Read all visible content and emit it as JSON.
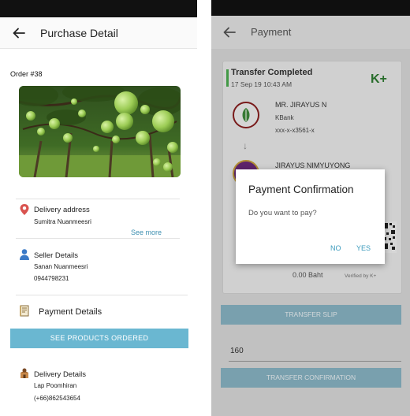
{
  "purchase": {
    "title": "Purchase Detail",
    "order_label": "Order #38",
    "delivery_address": {
      "title": "Delivery address",
      "name": "Sumitra Nuanmeesri",
      "see_more": "See more"
    },
    "seller": {
      "title": "Seller Details",
      "name": "Sanan Nuanmeesri",
      "phone": "0944798231"
    },
    "payment": {
      "title": "Payment Details",
      "button": "SEE PRODUCTS ORDERED"
    },
    "delivery": {
      "title": "Delivery Details",
      "name": "Lap Poomhiran",
      "phone": "(+66)862543654"
    }
  },
  "payment_screen": {
    "title": "Payment",
    "slip": {
      "status": "Transfer Completed",
      "datetime": "17 Sep 19  10:43 AM",
      "brand": "K+",
      "from_name": "MR. JIRAYUS N",
      "from_bank": "KBank",
      "from_account": "xxx-x-x3561-x",
      "to_name": "JIRAYUS NIMYUYONG",
      "amount": "0.00 Baht",
      "verified": "Verified by K+"
    },
    "transfer_slip_button": "TRANSFER SLIP",
    "amount_value": "160",
    "transfer_confirmation_button": "TRANSFER CONFIRMATION"
  },
  "dialog": {
    "title": "Payment Confirmation",
    "message": "Do you want to pay?",
    "no": "NO",
    "yes": "YES"
  },
  "colors": {
    "accent": "#6ab7d1",
    "link": "#3d8fb0",
    "location_pin": "#d9534f",
    "slip_accent": "#4caf50",
    "kplus": "#2e7d32"
  },
  "icons": [
    "back-arrow-icon",
    "location-pin-icon",
    "person-icon",
    "receipt-icon",
    "courier-icon",
    "kplus-logo",
    "qr-code-icon",
    "arrow-down-icon"
  ]
}
